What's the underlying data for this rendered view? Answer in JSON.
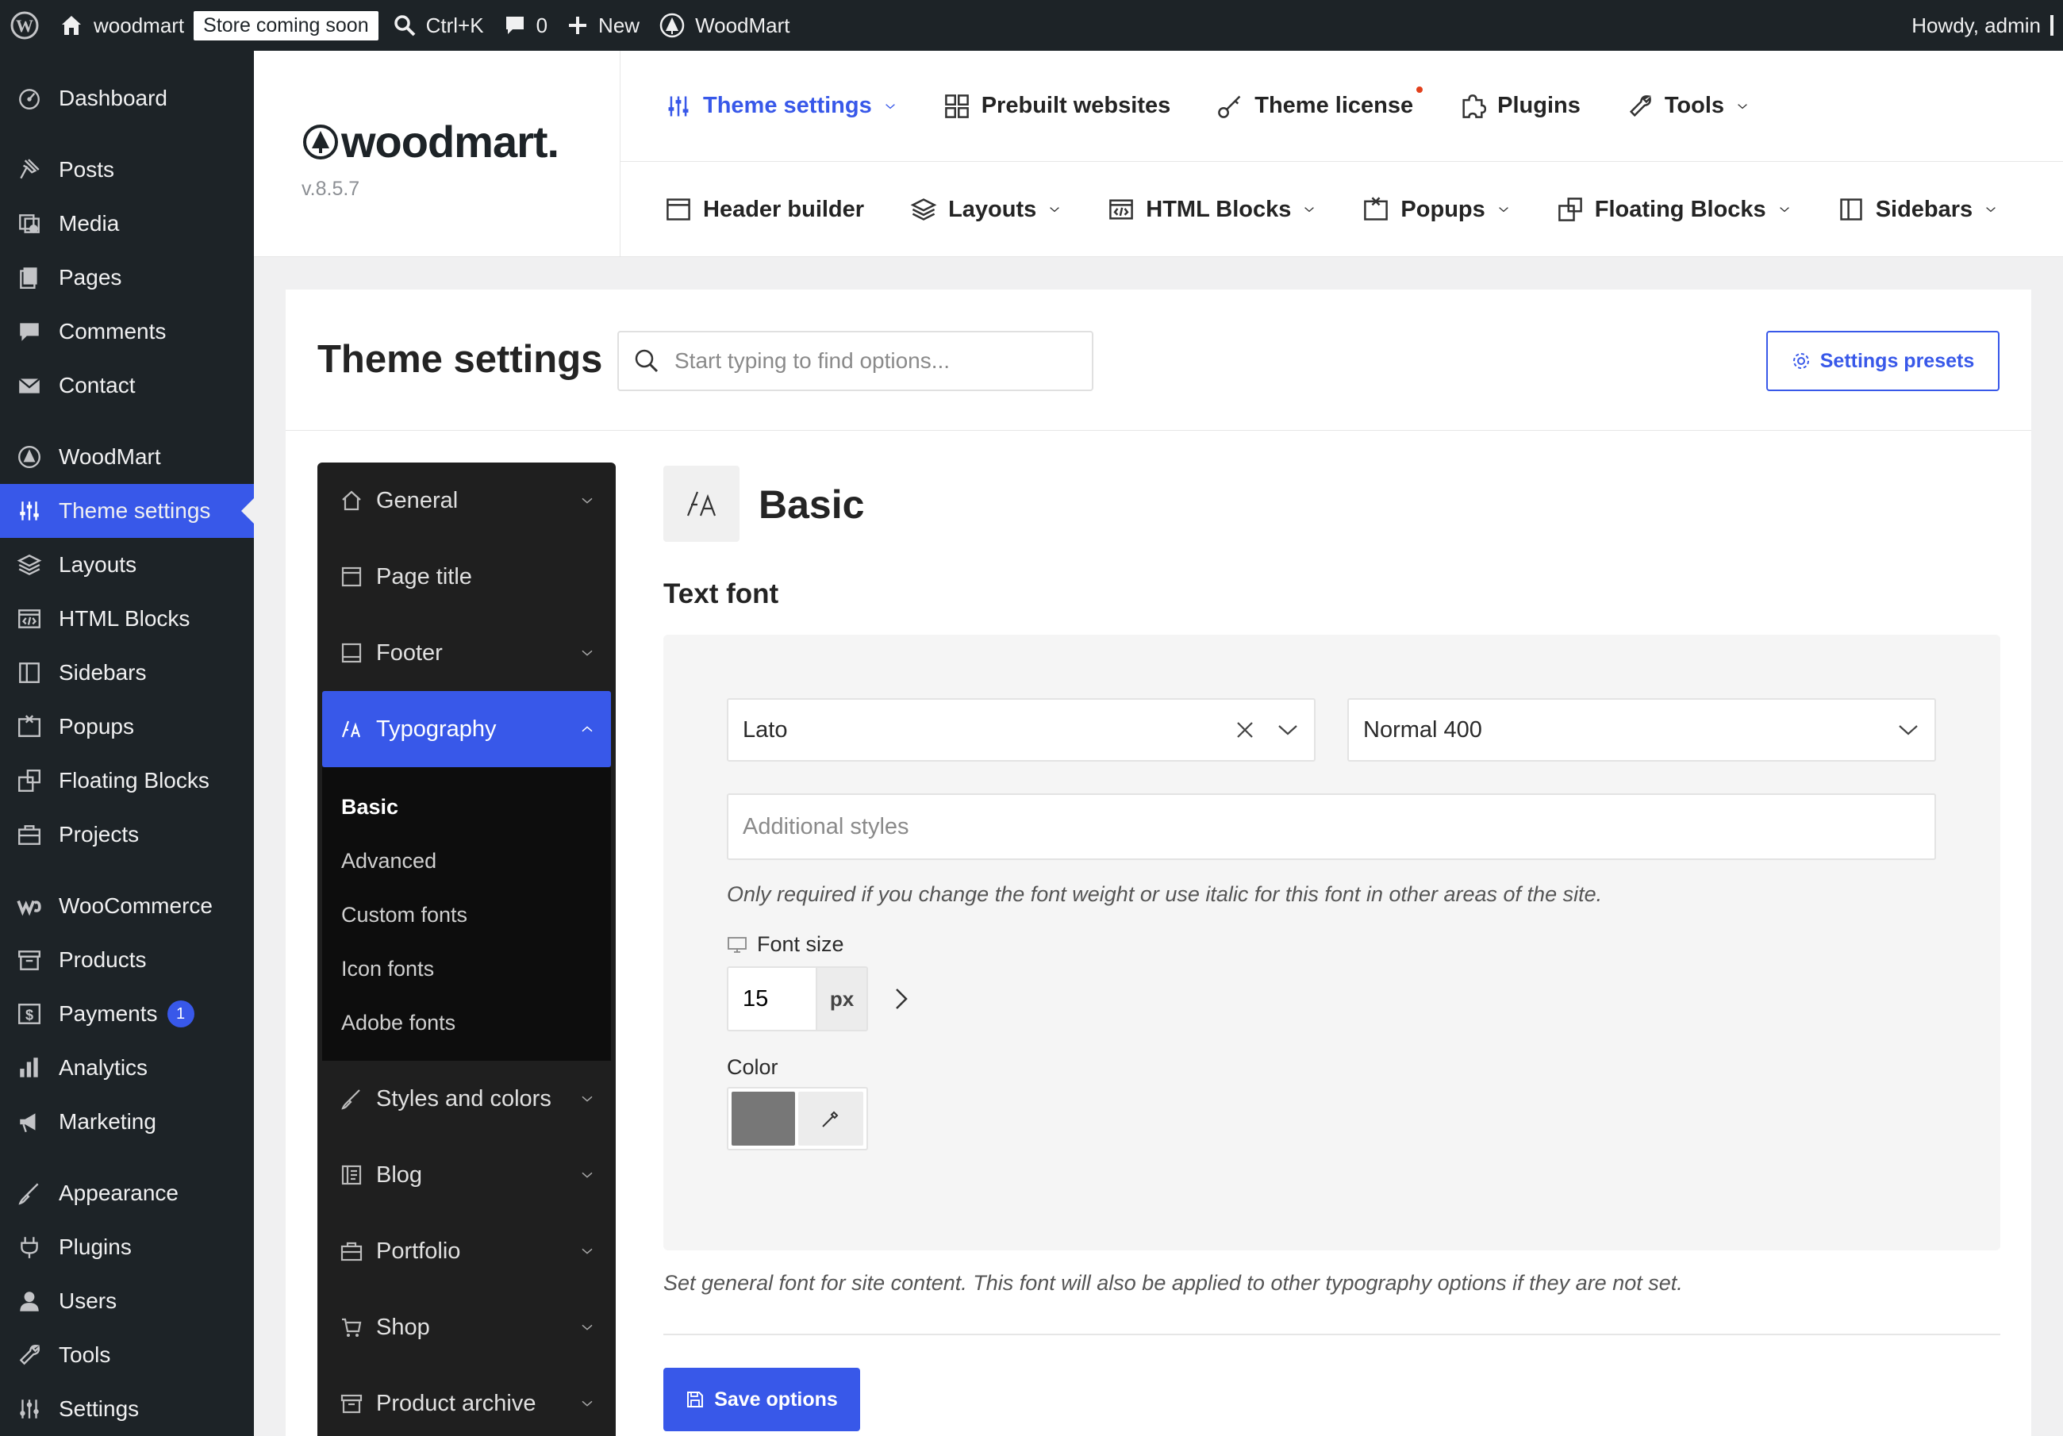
{
  "admin_bar": {
    "site_name": "woodmart",
    "store_badge": "Store coming soon",
    "search_shortcut": "Ctrl+K",
    "comments_count": "0",
    "new_label": "New",
    "woodmart_label": "WoodMart",
    "greeting": "Howdy, admin"
  },
  "side_menu": {
    "items": [
      {
        "label": "Dashboard",
        "icon": "dashboard-icon"
      },
      {
        "label": "Posts",
        "icon": "pin-icon"
      },
      {
        "label": "Media",
        "icon": "media-icon"
      },
      {
        "label": "Pages",
        "icon": "pages-icon"
      },
      {
        "label": "Comments",
        "icon": "comment-icon"
      },
      {
        "label": "Contact",
        "icon": "mail-icon"
      },
      {
        "label": "WoodMart",
        "icon": "woodmart-icon"
      },
      {
        "label": "Theme settings",
        "icon": "sliders-icon",
        "current": true
      },
      {
        "label": "Layouts",
        "icon": "layers-icon"
      },
      {
        "label": "HTML Blocks",
        "icon": "html-icon"
      },
      {
        "label": "Sidebars",
        "icon": "sidebar-icon"
      },
      {
        "label": "Popups",
        "icon": "popup-icon"
      },
      {
        "label": "Floating Blocks",
        "icon": "floating-icon"
      },
      {
        "label": "Projects",
        "icon": "briefcase-icon"
      },
      {
        "label": "WooCommerce",
        "icon": "woo-icon"
      },
      {
        "label": "Products",
        "icon": "archive-icon"
      },
      {
        "label": "Payments",
        "icon": "dollar-icon",
        "badge": "1"
      },
      {
        "label": "Analytics",
        "icon": "bar-chart-icon"
      },
      {
        "label": "Marketing",
        "icon": "megaphone-icon"
      },
      {
        "label": "Appearance",
        "icon": "brush-icon"
      },
      {
        "label": "Plugins",
        "icon": "plug-icon"
      },
      {
        "label": "Users",
        "icon": "user-icon"
      },
      {
        "label": "Tools",
        "icon": "wrench-icon"
      },
      {
        "label": "Settings",
        "icon": "settings-icon"
      }
    ]
  },
  "wd_header": {
    "logo_text": "woodmart.",
    "version": "v.8.5.7",
    "top_nav": [
      {
        "label": "Theme settings",
        "icon": "sliders-icon",
        "active": true,
        "dropdown": true
      },
      {
        "label": "Prebuilt websites",
        "icon": "grid-icon"
      },
      {
        "label": "Theme license",
        "icon": "key-icon",
        "dot": true
      },
      {
        "label": "Plugins",
        "icon": "puzzle-icon"
      },
      {
        "label": "Tools",
        "icon": "wrench-icon",
        "dropdown": true
      }
    ],
    "sub_nav": [
      {
        "label": "Header builder",
        "icon": "header-icon"
      },
      {
        "label": "Layouts",
        "icon": "layers-icon",
        "dropdown": true
      },
      {
        "label": "HTML Blocks",
        "icon": "html-icon",
        "dropdown": true
      },
      {
        "label": "Popups",
        "icon": "popup-icon",
        "dropdown": true
      },
      {
        "label": "Floating Blocks",
        "icon": "floating-icon",
        "dropdown": true
      },
      {
        "label": "Sidebars",
        "icon": "sidebar-icon",
        "dropdown": true
      }
    ]
  },
  "page": {
    "title": "Theme settings",
    "search_placeholder": "Start typing to find options...",
    "presets_label": "Settings presets"
  },
  "settings_nav": {
    "items_before": [
      {
        "label": "General",
        "icon": "home-icon",
        "dropdown": true
      },
      {
        "label": "Page title",
        "icon": "page-title-icon",
        "dropdown": false
      },
      {
        "label": "Footer",
        "icon": "footer-icon",
        "dropdown": true
      }
    ],
    "open_item": {
      "label": "Typography",
      "icon": "typography-icon"
    },
    "sub_items": [
      {
        "label": "Basic",
        "active": true
      },
      {
        "label": "Advanced"
      },
      {
        "label": "Custom fonts"
      },
      {
        "label": "Icon fonts"
      },
      {
        "label": "Adobe fonts"
      }
    ],
    "items_after": [
      {
        "label": "Styles and colors",
        "icon": "brush-icon",
        "dropdown": true
      },
      {
        "label": "Blog",
        "icon": "blog-icon",
        "dropdown": true
      },
      {
        "label": "Portfolio",
        "icon": "briefcase-icon",
        "dropdown": true
      },
      {
        "label": "Shop",
        "icon": "cart-icon",
        "dropdown": true
      },
      {
        "label": "Product archive",
        "icon": "archive-icon",
        "dropdown": true
      }
    ]
  },
  "content": {
    "section_title": "Basic",
    "field_title": "Text font",
    "font_family": "Lato",
    "font_weight": "Normal 400",
    "additional_styles_placeholder": "Additional styles",
    "hint": "Only required if you change the font weight or use italic for this font in other areas of the site.",
    "font_size_label": "Font size",
    "font_size_value": "15",
    "font_size_unit": "px",
    "color_label": "Color",
    "color_value": "#777777",
    "description": "Set general font for site content. This font will also be applied to other typography options if they are not set.",
    "save_label": "Save options"
  }
}
